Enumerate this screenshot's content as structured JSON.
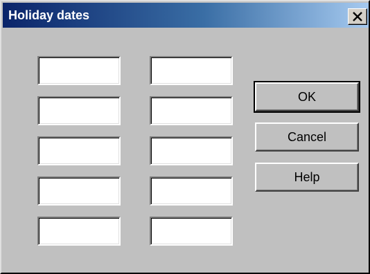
{
  "dialog": {
    "title": "Holiday dates",
    "close_icon": "close-x-icon"
  },
  "fields": {
    "left": [
      "",
      "",
      "",
      "",
      ""
    ],
    "right": [
      "",
      "",
      "",
      "",
      ""
    ]
  },
  "buttons": {
    "ok_label": "OK",
    "cancel_label": "Cancel",
    "help_label": "Help"
  },
  "colors": {
    "face": "#c0c0c0",
    "title_start": "#0a246a",
    "title_end": "#a6caf0",
    "title_text": "#ffffff"
  }
}
